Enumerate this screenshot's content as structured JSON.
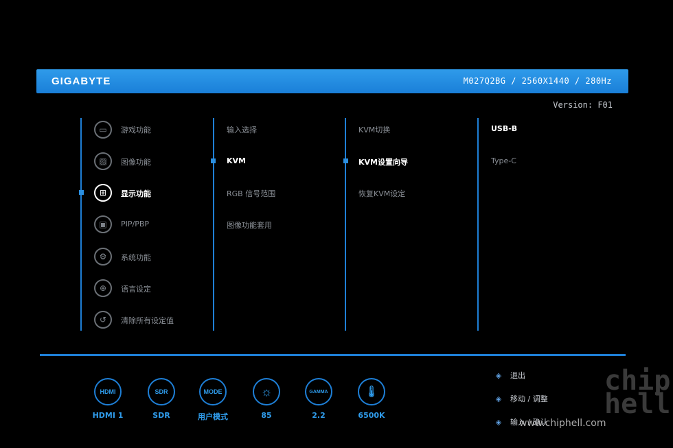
{
  "header": {
    "brand": "GIGABYTE",
    "model": "M027Q2BG  /  2560X1440  /  280Hz",
    "version": "Version: F01"
  },
  "menu": {
    "main": [
      {
        "label": "游戏功能",
        "icon": "gamepad-icon"
      },
      {
        "label": "图像功能",
        "icon": "picture-icon"
      },
      {
        "label": "显示功能",
        "icon": "display-grid-icon",
        "selected": true
      },
      {
        "label": "PIP/PBP",
        "icon": "pip-icon"
      },
      {
        "label": "系统功能",
        "icon": "system-gear-icon"
      },
      {
        "label": "语言设定",
        "icon": "globe-icon"
      },
      {
        "label": "清除所有设定值",
        "icon": "reset-icon"
      }
    ],
    "sub": [
      {
        "label": "输入选择"
      },
      {
        "label": "KVM",
        "selected": true
      },
      {
        "label": "RGB 信号范围"
      },
      {
        "label": "图像功能套用"
      }
    ],
    "sub2": [
      {
        "label": "KVM切换"
      },
      {
        "label": "KVM设置向导",
        "selected": true
      },
      {
        "label": "恢复KVM设定"
      }
    ],
    "sub3": [
      {
        "label": "USB-B",
        "selected": true
      },
      {
        "label": "Type-C"
      }
    ]
  },
  "status": [
    {
      "icon_text": "HDMI",
      "label": "HDMI 1"
    },
    {
      "icon_text": "SDR",
      "label": "SDR"
    },
    {
      "icon_text": "MODE",
      "label": "用户模式"
    },
    {
      "icon_text": "☼",
      "label": "85"
    },
    {
      "icon_text": "GAMMA",
      "label": "2.2"
    },
    {
      "icon_text": "🌡",
      "label": "6500K"
    }
  ],
  "hints": [
    {
      "label": "退出"
    },
    {
      "label": "移动 / 调整"
    },
    {
      "label": "输入 / 确认"
    }
  ],
  "watermark": {
    "text": "www.chiphell.com",
    "logo": "chip hell"
  },
  "colors": {
    "accent": "#1e7fd6",
    "header": "#2f9bea",
    "selected_text": "#ffffff",
    "normal_text": "#8a8f96"
  }
}
